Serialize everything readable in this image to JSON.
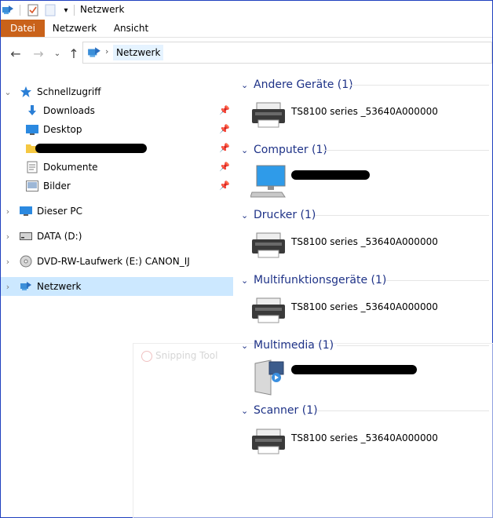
{
  "window": {
    "title": "Netzwerk"
  },
  "ribbon": {
    "tabs": [
      "Datei",
      "Netzwerk",
      "Ansicht"
    ]
  },
  "address": {
    "crumb": "Netzwerk"
  },
  "nav": {
    "quick_access": "Schnellzugriff",
    "quick_items": [
      {
        "label": "Downloads",
        "icon": "download-icon"
      },
      {
        "label": "Desktop",
        "icon": "desktop-icon"
      },
      {
        "label": "",
        "icon": "folder-icon"
      },
      {
        "label": "Dokumente",
        "icon": "documents-icon"
      },
      {
        "label": "Bilder",
        "icon": "pictures-icon"
      }
    ],
    "roots": [
      {
        "label": "Dieser PC",
        "icon": "this-pc-icon"
      },
      {
        "label": "DATA (D:)",
        "icon": "drive-icon"
      },
      {
        "label": "DVD-RW-Laufwerk (E:) CANON_IJ",
        "icon": "dvd-drive-icon"
      },
      {
        "label": "Netzwerk",
        "icon": "network-icon"
      }
    ]
  },
  "groups": [
    {
      "header": "Andere Geräte (1)",
      "item": "TS8100 series _53640A000000",
      "icon": "printer-icon"
    },
    {
      "header": "Computer (1)",
      "item": "",
      "icon": "computer-icon"
    },
    {
      "header": "Drucker (1)",
      "item": "TS8100 series _53640A000000",
      "icon": "printer-icon"
    },
    {
      "header": "Multifunktionsgeräte (1)",
      "item": "TS8100 series _53640A000000",
      "icon": "printer-icon"
    },
    {
      "header": "Multimedia (1)",
      "item": "",
      "icon": "media-server-icon"
    },
    {
      "header": "Scanner (1)",
      "item": "TS8100 series _53640A000000",
      "icon": "printer-icon"
    }
  ],
  "overlay": {
    "label": "Snipping Tool"
  },
  "colors": {
    "file_tab": "#c9621a",
    "group_header": "#1e3287",
    "selection": "#cce8ff"
  }
}
